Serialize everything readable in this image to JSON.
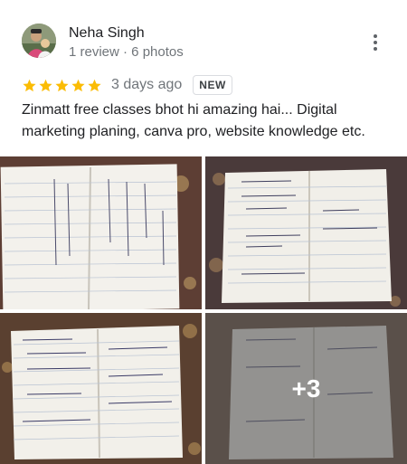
{
  "review": {
    "author_name": "Neha Singh",
    "meta": "1 review · 6 photos",
    "rating": 5,
    "time": "3 days ago",
    "badge": "NEW",
    "text": "Zinmatt free  classes bhot hi amazing hai... Digital marketing planing, canva pro, website knowledge etc.",
    "star_color": "#fbbc04"
  },
  "photos": {
    "more_label": "+3"
  }
}
